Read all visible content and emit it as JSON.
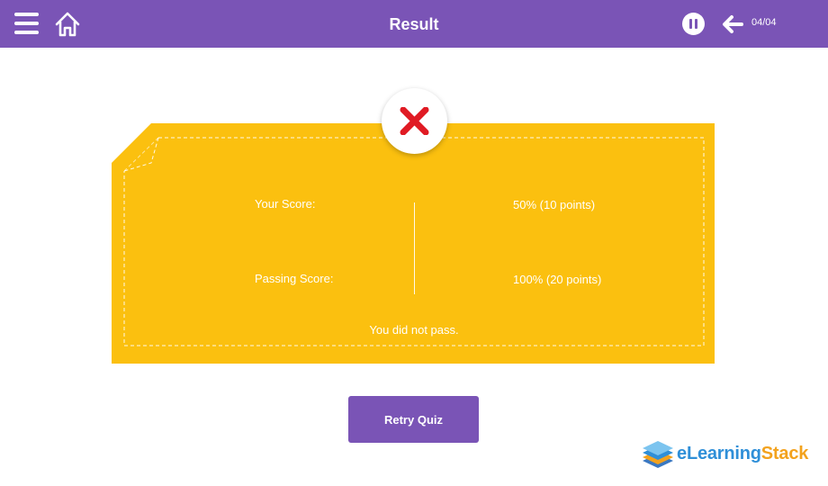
{
  "header": {
    "title": "Result",
    "counter": "04/04"
  },
  "result": {
    "status_icon": "cross-icon",
    "your_score_label": "Your Score:",
    "your_score_value": "50% (10 points)",
    "passing_score_label": "Passing Score:",
    "passing_score_value": "100% (20 points)",
    "message": "You did not pass."
  },
  "actions": {
    "retry_label": "Retry Quiz"
  },
  "branding": {
    "logo_e": "e",
    "logo_learning": "Learning",
    "logo_stack": "Stack"
  },
  "colors": {
    "header_bg": "#7a54b6",
    "card_bg": "#fbc00f",
    "fail_red": "#e01b24",
    "button_bg": "#7a54b6"
  }
}
